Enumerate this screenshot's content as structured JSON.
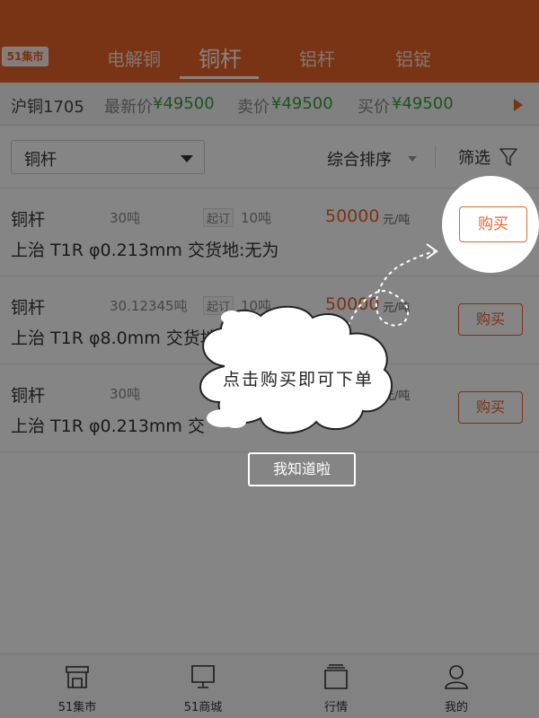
{
  "header": {
    "logo": "51集市",
    "tabs": [
      {
        "label": "电解铜",
        "active": false
      },
      {
        "label": "铜杆",
        "active": true
      },
      {
        "label": "铝杆",
        "active": false
      },
      {
        "label": "铝锭",
        "active": false
      }
    ]
  },
  "ticker": {
    "contract": "沪铜1705",
    "latest_label": "最新价",
    "latest_value": "¥49500",
    "sell_label": "卖价",
    "sell_value": "¥49500",
    "buy_label": "买价",
    "buy_value": "¥49500"
  },
  "filters": {
    "category_value": "铜杆",
    "sort_label": "综合排序",
    "filter_label": "筛选"
  },
  "listings": [
    {
      "name": "铜杆",
      "qty": "30吨",
      "moq_tag": "起订",
      "moq": "10吨",
      "price": "50000",
      "unit": "元/吨",
      "spec": "上治  T1R  φ0.213mm  交货地:无为",
      "buy": "购买"
    },
    {
      "name": "铜杆",
      "qty": "30.12345吨",
      "moq_tag": "起订",
      "moq": "10吨",
      "price": "50000",
      "unit": "元/吨",
      "spec": "上治  T1R  φ8.0mm  交货地:",
      "buy": "购买"
    },
    {
      "name": "铜杆",
      "qty": "30吨",
      "moq_tag": "",
      "moq": "",
      "price": "",
      "unit": "元/吨",
      "spec": "上治  T1R  φ0.213mm  交",
      "buy": "购买"
    }
  ],
  "bottom_nav": [
    {
      "label": "51集市",
      "icon": "store-icon"
    },
    {
      "label": "51商城",
      "icon": "monitor-icon"
    },
    {
      "label": "行情",
      "icon": "market-icon"
    },
    {
      "label": "我的",
      "icon": "user-icon"
    }
  ],
  "guide": {
    "highlight_button": "购买",
    "message": "点击购买即可下单",
    "dismiss": "我知道啦"
  },
  "colors": {
    "accent": "#e8642a",
    "price_green": "#3aa23a"
  }
}
